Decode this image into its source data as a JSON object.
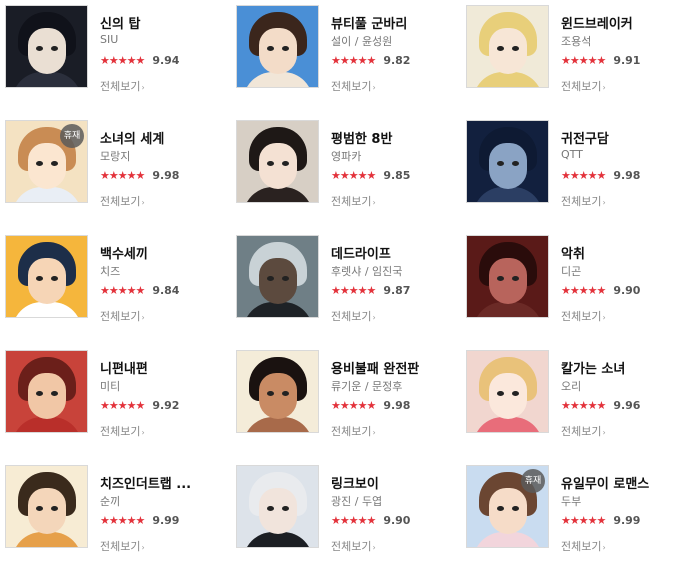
{
  "more_label": "전체보기",
  "pause_badge_label": "휴재",
  "star_glyphs": "★★★★★",
  "items": [
    {
      "title": "신의 탑",
      "author": "SIU",
      "score": "9.94",
      "paused": false,
      "colors": {
        "bg": "#1a1d26",
        "hair": "#10121a",
        "face": "#eadfd3",
        "shoulders": "#2b2f3c"
      }
    },
    {
      "title": "뷰티풀 군바리",
      "author": "설이 / 윤성원",
      "score": "9.82",
      "paused": false,
      "colors": {
        "bg": "#4a8fd6",
        "hair": "#3b261c",
        "face": "#f3dcc8",
        "shoulders": "#f1e6d8"
      }
    },
    {
      "title": "윈드브레이커",
      "author": "조용석",
      "score": "9.91",
      "paused": false,
      "colors": {
        "bg": "#f0ead8",
        "hair": "#e8cf7a",
        "face": "#f7e6d6",
        "shoulders": "#e8cf7a"
      }
    },
    {
      "title": "소녀의 세계",
      "author": "모랑지",
      "score": "9.98",
      "paused": true,
      "colors": {
        "bg": "#f4e2c2",
        "hair": "#c98c54",
        "face": "#fbe6d0",
        "shoulders": "#e9eef5"
      }
    },
    {
      "title": "평범한 8반",
      "author": "영파카",
      "score": "9.85",
      "paused": false,
      "colors": {
        "bg": "#d7cfc5",
        "hair": "#1e1816",
        "face": "#f4e1d3",
        "shoulders": "#2a2220"
      }
    },
    {
      "title": "귀전구담",
      "author": "QTT",
      "score": "9.98",
      "paused": false,
      "colors": {
        "bg": "#12203e",
        "hair": "#0e1a33",
        "face": "#8aa3c4",
        "shoulders": "#2b3e63"
      }
    },
    {
      "title": "백수세끼",
      "author": "치즈",
      "score": "9.84",
      "paused": false,
      "colors": {
        "bg": "#f5b63c",
        "hair": "#1d2e49",
        "face": "#f6d5b6",
        "shoulders": "#ffffff"
      }
    },
    {
      "title": "데드라이프",
      "author": "후렛샤 / 임진국",
      "score": "9.87",
      "paused": false,
      "colors": {
        "bg": "#6f7f86",
        "hair": "#c9d2d6",
        "face": "#5c4a3e",
        "shoulders": "#1e2226"
      }
    },
    {
      "title": "악취",
      "author": "디곤",
      "score": "9.90",
      "paused": false,
      "colors": {
        "bg": "#5a1a18",
        "hair": "#2a0c0b",
        "face": "#b8645c",
        "shoulders": "#6b2a26"
      }
    },
    {
      "title": "니편내편",
      "author": "미티",
      "score": "9.92",
      "paused": false,
      "colors": {
        "bg": "#c8433a",
        "hair": "#6b1f1a",
        "face": "#f1c7a6",
        "shoulders": "#b92f2a"
      }
    },
    {
      "title": "용비불패 완전판",
      "author": "류기운 / 문정후",
      "score": "9.98",
      "paused": false,
      "colors": {
        "bg": "#f4ecd9",
        "hair": "#1a1210",
        "face": "#c98b64",
        "shoulders": "#a86a4a"
      }
    },
    {
      "title": "칼가는 소녀",
      "author": "오리",
      "score": "9.96",
      "paused": false,
      "colors": {
        "bg": "#f1d6cf",
        "hair": "#e9c27a",
        "face": "#fbe8dc",
        "shoulders": "#e86d7a"
      }
    },
    {
      "title": "치즈인더트랩 ...",
      "author": "순끼",
      "score": "9.99",
      "paused": false,
      "colors": {
        "bg": "#f7ecd4",
        "hair": "#3a2a1c",
        "face": "#f4d6ba",
        "shoulders": "#e6a04a"
      }
    },
    {
      "title": "링크보이",
      "author": "광진 / 두엽",
      "score": "9.90",
      "paused": false,
      "colors": {
        "bg": "#dde3ea",
        "hair": "#e9ebee",
        "face": "#f1e4dc",
        "shoulders": "#1c1f24"
      }
    },
    {
      "title": "유일무이 로맨스",
      "author": "두부",
      "score": "9.99",
      "paused": true,
      "colors": {
        "bg": "#c9dcf0",
        "hair": "#6b4632",
        "face": "#f6dcc8",
        "shoulders": "#f2d5dc"
      }
    }
  ]
}
